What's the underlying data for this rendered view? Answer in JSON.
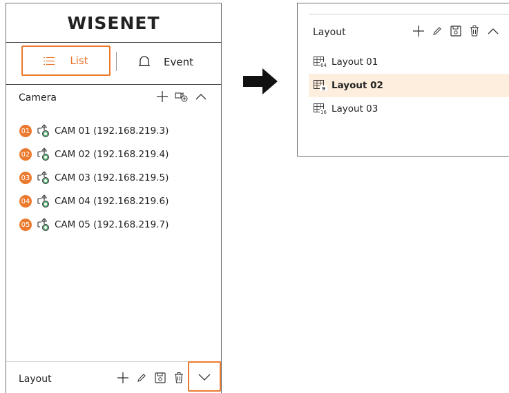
{
  "brand": {
    "logo_text": "WISENET"
  },
  "tabs": {
    "list_label": "List",
    "event_label": "Event"
  },
  "camera_section": {
    "title": "Camera",
    "items": [
      {
        "badge": "01",
        "label": "CAM 01 (192.168.219.3)"
      },
      {
        "badge": "02",
        "label": "CAM 02 (192.168.219.4)"
      },
      {
        "badge": "03",
        "label": "CAM 03 (192.168.219.5)"
      },
      {
        "badge": "04",
        "label": "CAM 04 (192.168.219.6)"
      },
      {
        "badge": "05",
        "label": "CAM 05 (192.168.219.7)"
      }
    ]
  },
  "layout_section_collapsed": {
    "title": "Layout"
  },
  "layout_section_expanded": {
    "title": "Layout",
    "items": [
      {
        "label": "Layout 01",
        "grid_badge": "64",
        "selected": false
      },
      {
        "label": "Layout 02",
        "grid_badge": "9",
        "selected": true
      },
      {
        "label": "Layout 03",
        "grid_badge": "16",
        "selected": false
      }
    ]
  },
  "colors": {
    "accent": "#ec7a2e",
    "selected_row": "#fdeedd",
    "camera_status": "#5fb37a"
  },
  "icons": [
    "list-icon",
    "bell-icon",
    "plus-icon",
    "add-camera-icon",
    "chevron-up-icon",
    "chevron-down-icon",
    "pencil-icon",
    "save-icon",
    "trash-icon",
    "camera-icon",
    "layout-grid-icon",
    "right-arrow-icon"
  ]
}
